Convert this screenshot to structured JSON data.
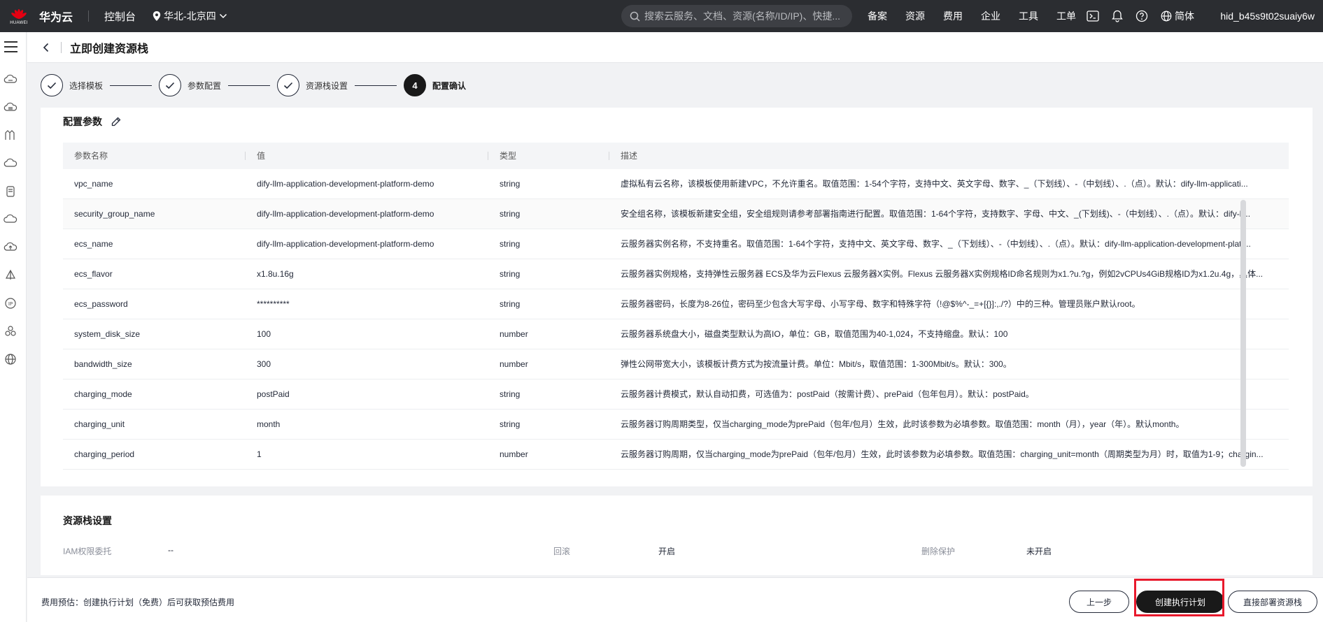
{
  "topbar": {
    "logo_text": "HUAWEI",
    "brand": "华为云",
    "console": "控制台",
    "region": "华北-北京四",
    "search_placeholder": "搜索云服务、文档、资源(名称/ID/IP)、快捷...",
    "nav": [
      "备案",
      "资源",
      "费用",
      "企业",
      "工具",
      "工单"
    ],
    "icons": [
      "terminal-icon",
      "bell-icon",
      "help-icon"
    ],
    "language": "简体",
    "user": "hid_b45s9t02suaiy6w"
  },
  "page": {
    "title": "立即创建资源栈"
  },
  "steps": [
    {
      "label": "选择模板",
      "state": "done"
    },
    {
      "label": "参数配置",
      "state": "done"
    },
    {
      "label": "资源栈设置",
      "state": "done"
    },
    {
      "label": "配置确认",
      "state": "active",
      "number": "4"
    }
  ],
  "params": {
    "title": "配置参数",
    "columns": [
      "参数名称",
      "值",
      "类型",
      "描述"
    ],
    "rows": [
      {
        "name": "vpc_name",
        "value": "dify-llm-application-development-platform-demo",
        "type": "string",
        "desc": "虚拟私有云名称，该模板使用新建VPC，不允许重名。取值范围：1-54个字符，支持中文、英文字母、数字、_（下划线）、-（中划线）、.（点）。默认：dify-llm-applicati..."
      },
      {
        "name": "security_group_name",
        "value": "dify-llm-application-development-platform-demo",
        "type": "string",
        "desc": "安全组名称，该模板新建安全组，安全组规则请参考部署指南进行配置。取值范围：1-64个字符，支持数字、字母、中文、_(下划线)、-（中划线）、.（点）。默认：dify-ll..."
      },
      {
        "name": "ecs_name",
        "value": "dify-llm-application-development-platform-demo",
        "type": "string",
        "desc": "云服务器实例名称，不支持重名。取值范围：1-64个字符，支持中文、英文字母、数字、_（下划线）、-（中划线）、.（点）。默认：dify-llm-application-development-platf..."
      },
      {
        "name": "ecs_flavor",
        "value": "x1.8u.16g",
        "type": "string",
        "desc": "云服务器实例规格，支持弹性云服务器 ECS及华为云Flexus 云服务器X实例。Flexus 云服务器X实例规格ID命名规则为x1.?u.?g，例如2vCPUs4GiB规格ID为x1.2u.4g，具体..."
      },
      {
        "name": "ecs_password",
        "value": "**********",
        "type": "string",
        "desc": "云服务器密码，长度为8-26位，密码至少包含大写字母、小写字母、数字和特殊字符（!@$%^-_=+[{}]:,./?）中的三种。管理员账户默认root。"
      },
      {
        "name": "system_disk_size",
        "value": "100",
        "type": "number",
        "desc": "云服务器系统盘大小，磁盘类型默认为高IO，单位：GB，取值范围为40-1,024，不支持缩盘。默认：100"
      },
      {
        "name": "bandwidth_size",
        "value": "300",
        "type": "number",
        "desc": "弹性公网带宽大小，该模板计费方式为按流量计费。单位：Mbit/s，取值范围：1-300Mbit/s。默认：300。"
      },
      {
        "name": "charging_mode",
        "value": "postPaid",
        "type": "string",
        "desc": "云服务器计费模式，默认自动扣费，可选值为：postPaid（按需计费）、prePaid（包年包月）。默认：postPaid。"
      },
      {
        "name": "charging_unit",
        "value": "month",
        "type": "string",
        "desc": "云服务器订购周期类型，仅当charging_mode为prePaid（包年/包月）生效，此时该参数为必填参数。取值范围：month（月），year（年）。默认month。"
      },
      {
        "name": "charging_period",
        "value": "1",
        "type": "number",
        "desc": "云服务器订购周期，仅当charging_mode为prePaid（包年/包月）生效，此时该参数为必填参数。取值范围：charging_unit=month（周期类型为月）时，取值为1-9；chargin..."
      }
    ]
  },
  "stack_settings": {
    "title": "资源栈设置",
    "iam_label": "IAM权限委托",
    "iam_value": "--",
    "rollback_label": "回滚",
    "rollback_value": "开启",
    "delete_protect_label": "删除保护",
    "delete_protect_value": "未开启"
  },
  "footer": {
    "fee_note": "费用预估：创建执行计划（免费）后可获取预估费用",
    "prev": "上一步",
    "create_plan": "创建执行计划",
    "deploy": "直接部署资源栈"
  }
}
